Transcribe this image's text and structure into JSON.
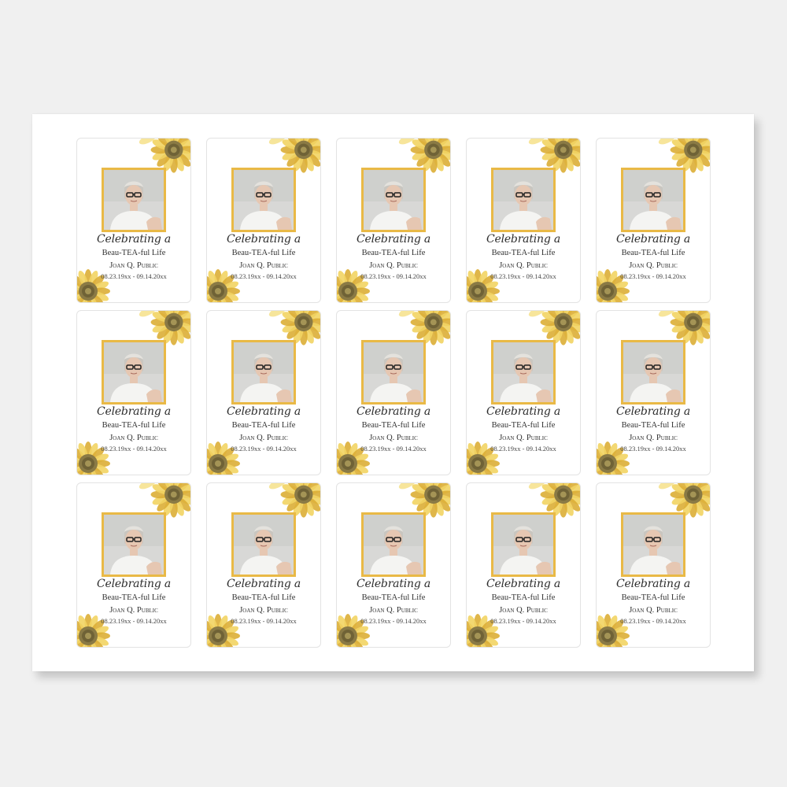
{
  "label": {
    "title": "Celebrating a",
    "subtitle": "Beau-TEA-ful Life",
    "name": "Joan Q. Public",
    "dates": "08.23.19xx - 09.14.20xx"
  },
  "sheet": {
    "rows": 3,
    "columns": 5
  },
  "colors": {
    "frame": "#e9b946",
    "petal": "#f2d463",
    "petal_shadow": "#dcae36",
    "center": "#8a7a45",
    "background": "#f0f0f0"
  },
  "icons": {
    "flower": "sunflower-icon",
    "photo": "portrait-photo"
  }
}
